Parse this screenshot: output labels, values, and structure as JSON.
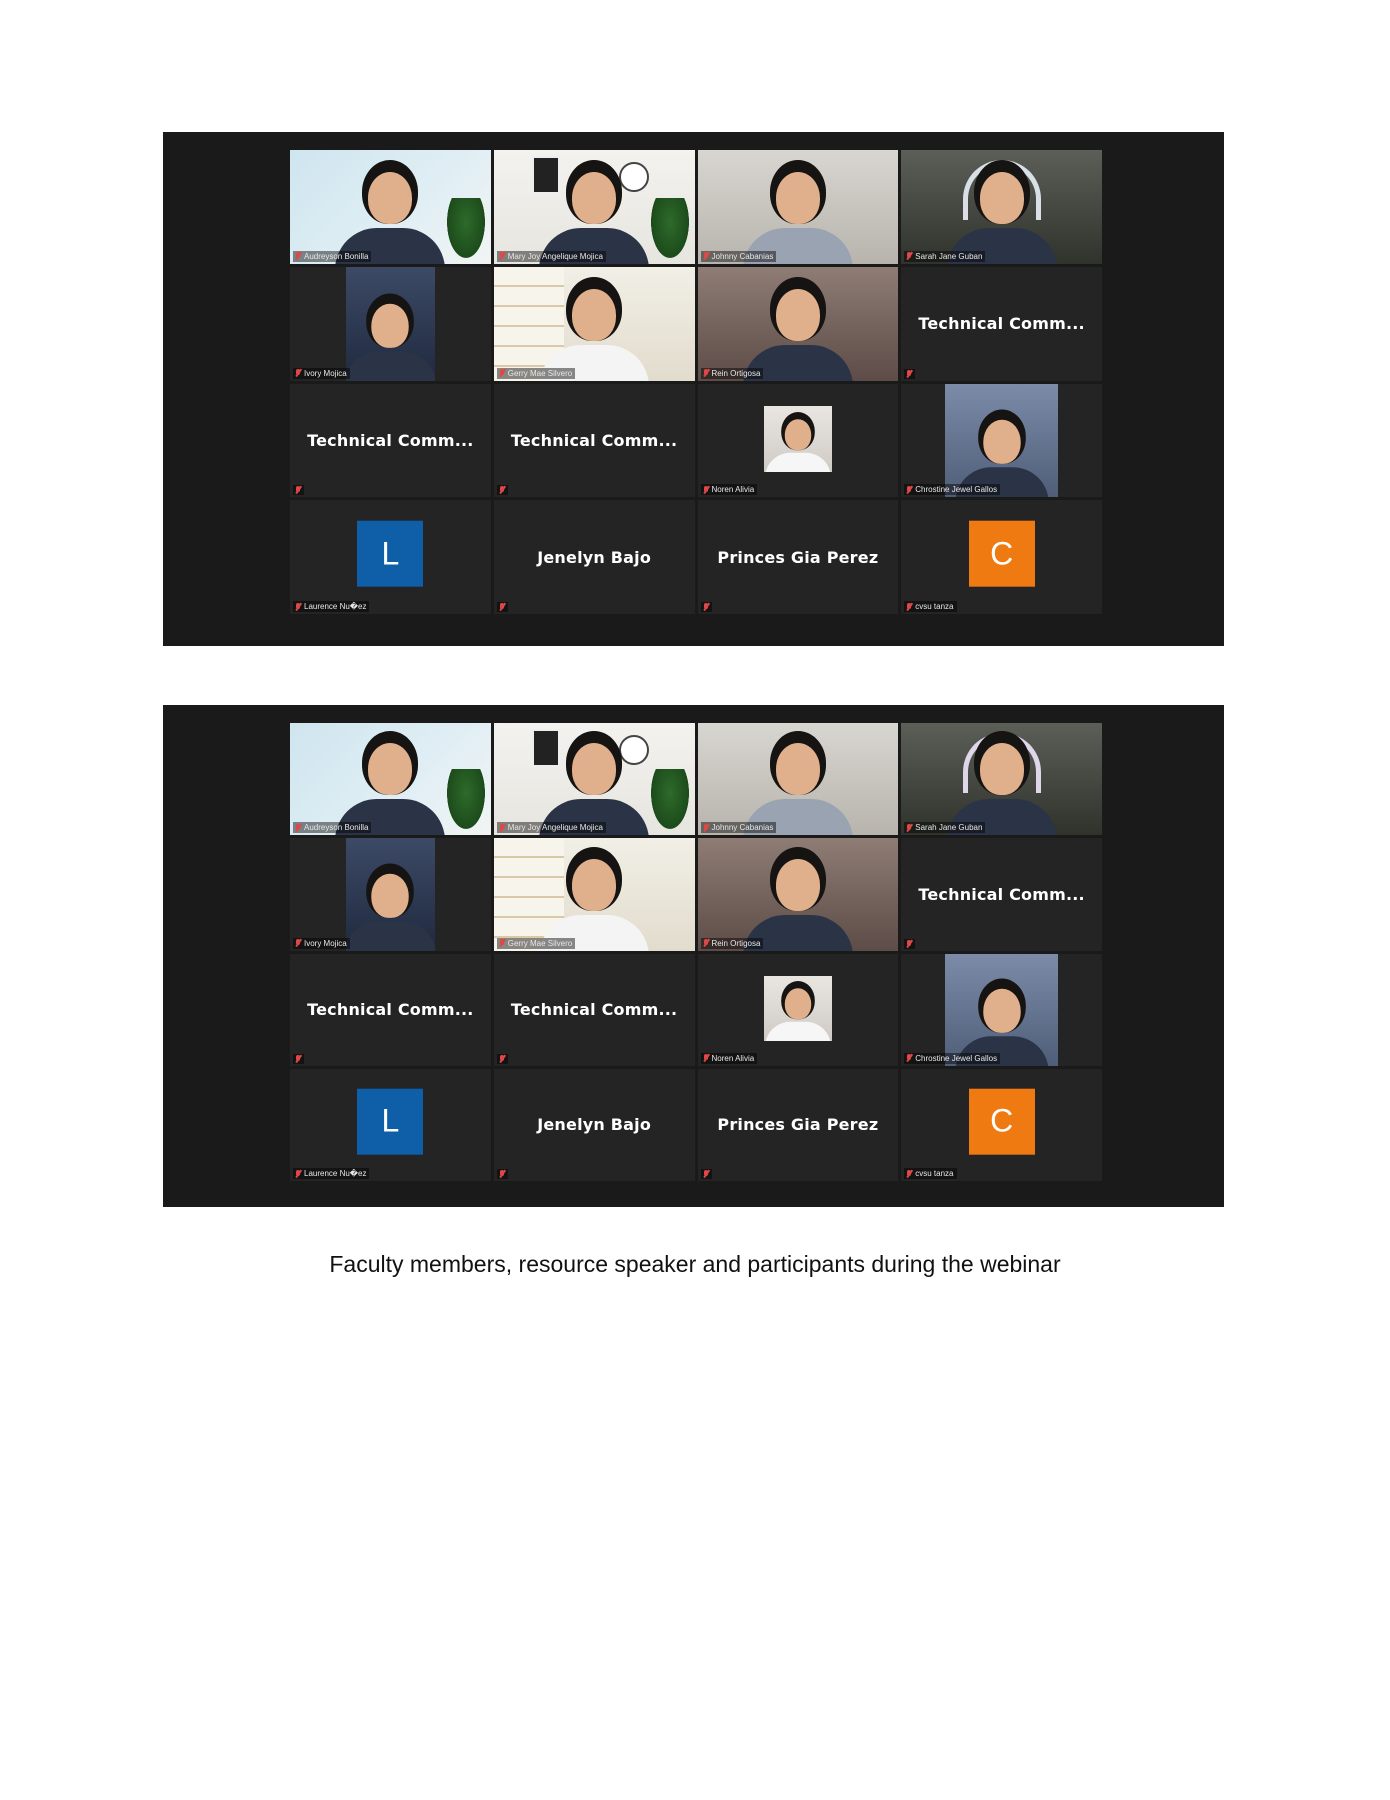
{
  "screenshots": [
    {
      "tiles": [
        {
          "name": "Audreyson Bonilla",
          "kind": "video",
          "bg": "room1"
        },
        {
          "name": "Mary Joy Angelique Mojica",
          "kind": "video",
          "bg": "room2",
          "active": true
        },
        {
          "name": "Johnny Cabanias",
          "kind": "video",
          "bg": "room3"
        },
        {
          "name": "Sarah Jane Guban",
          "kind": "video",
          "bg": "room4"
        },
        {
          "name": "Ivory Mojica",
          "kind": "video-small",
          "bg": "room5"
        },
        {
          "name": "Gerry Mae Silvero",
          "kind": "video",
          "bg": "room6"
        },
        {
          "name": "Rein Ortigosa",
          "kind": "video",
          "bg": "room7"
        },
        {
          "label": "Technical  Comm...",
          "kind": "text"
        },
        {
          "label": "Technical  Comm...",
          "kind": "text"
        },
        {
          "label": "Technical  Comm...",
          "kind": "text"
        },
        {
          "name": "Noren Alivia",
          "kind": "video-tiny",
          "bg": "room8"
        },
        {
          "name": "Chrostine Jewel Gallos",
          "kind": "video-portrait",
          "bg": "room9"
        },
        {
          "name": "Laurence Nu�ez",
          "kind": "avatar",
          "letter": "L",
          "color": "#0e5ea8"
        },
        {
          "label": "Jenelyn Bajo",
          "kind": "text"
        },
        {
          "label": "Princes Gia Perez",
          "kind": "text"
        },
        {
          "name": "cvsu tanza",
          "kind": "avatar",
          "letter": "C",
          "color": "#f07a12"
        }
      ]
    },
    {
      "tiles": [
        {
          "name": "Audreyson Bonilla",
          "kind": "video",
          "bg": "room1"
        },
        {
          "name": "Mary Joy Angelique Mojica",
          "kind": "video",
          "bg": "room2",
          "active": true
        },
        {
          "name": "Johnny Cabanias",
          "kind": "video",
          "bg": "room3"
        },
        {
          "name": "Sarah Jane Guban",
          "kind": "video",
          "bg": "room4",
          "headphones": "pink"
        },
        {
          "name": "Ivory Mojica",
          "kind": "video-small",
          "bg": "room5"
        },
        {
          "name": "Gerry Mae Silvero",
          "kind": "video",
          "bg": "room6"
        },
        {
          "name": "Rein Ortigosa",
          "kind": "video",
          "bg": "room7"
        },
        {
          "label": "Technical  Comm...",
          "kind": "text"
        },
        {
          "label": "Technical  Comm...",
          "kind": "text"
        },
        {
          "label": "Technical  Comm...",
          "kind": "text"
        },
        {
          "name": "Noren Alivia",
          "kind": "video-tiny",
          "bg": "room8"
        },
        {
          "name": "Chrostine Jewel Gallos",
          "kind": "video-portrait",
          "bg": "room9"
        },
        {
          "name": "Laurence Nu�ez",
          "kind": "avatar",
          "letter": "L",
          "color": "#0e5ea8"
        },
        {
          "label": "Jenelyn Bajo",
          "kind": "text"
        },
        {
          "label": "Princes Gia Perez",
          "kind": "text"
        },
        {
          "name": "cvsu tanza",
          "kind": "avatar",
          "letter": "C",
          "color": "#f07a12"
        }
      ]
    }
  ],
  "caption": "Faculty members, resource speaker and participants during the webinar"
}
